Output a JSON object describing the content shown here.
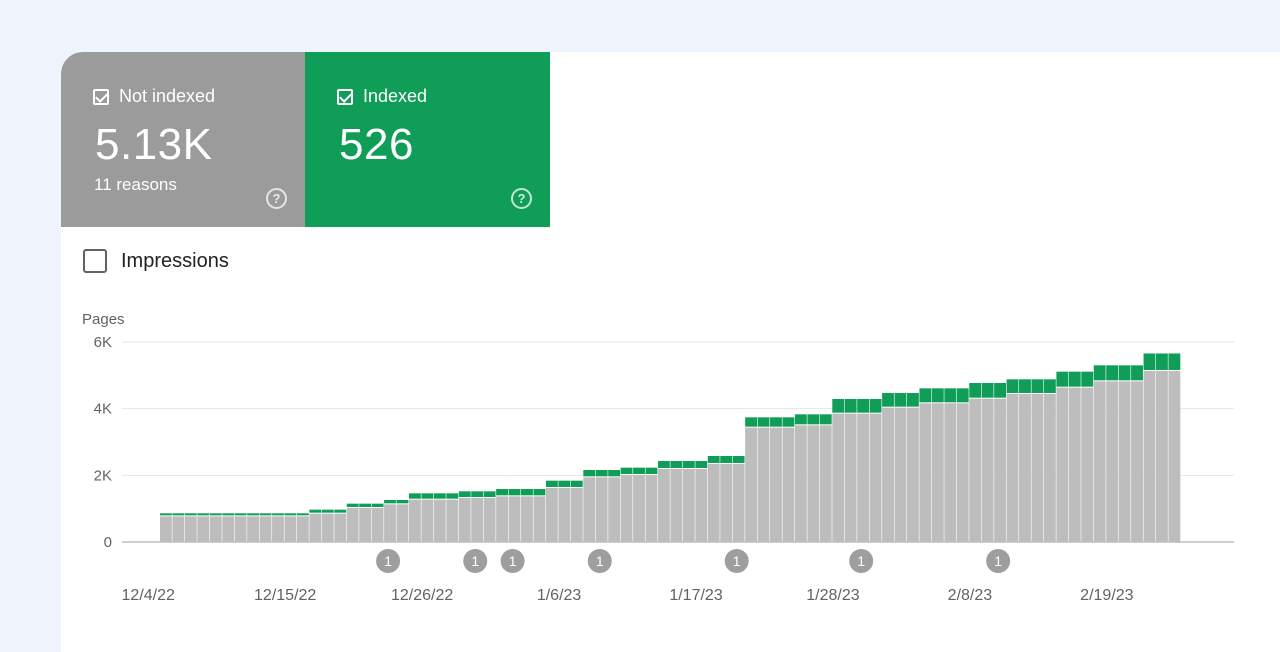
{
  "tiles": {
    "not_indexed": {
      "label": "Not indexed",
      "value": "5.13K",
      "sub": "11 reasons",
      "color": "#9b9b9b"
    },
    "indexed": {
      "label": "Indexed",
      "value": "526",
      "color": "#0f9d58"
    }
  },
  "impressions_label": "Impressions",
  "chart_data": {
    "type": "bar",
    "stacked": true,
    "ylabel": "Pages",
    "ylim": [
      0,
      6000
    ],
    "yticks": [
      "0",
      "2K",
      "4K",
      "6K"
    ],
    "ytick_values": [
      0,
      2000,
      4000,
      6000
    ],
    "grid": true,
    "x_tick_labels": [
      "12/4/22",
      "12/15/22",
      "12/26/22",
      "1/6/23",
      "1/17/23",
      "1/28/23",
      "2/8/23",
      "2/19/23"
    ],
    "x_tick_index": [
      0,
      11,
      22,
      33,
      44,
      55,
      66,
      77
    ],
    "series": [
      {
        "name": "Not indexed",
        "color": "#bdbdbd",
        "values": [
          770,
          770,
          770,
          770,
          770,
          770,
          770,
          770,
          770,
          770,
          770,
          770,
          850,
          850,
          850,
          1020,
          1020,
          1020,
          1130,
          1130,
          1270,
          1270,
          1270,
          1270,
          1320,
          1320,
          1320,
          1370,
          1370,
          1370,
          1370,
          1620,
          1620,
          1620,
          1940,
          1940,
          1940,
          2010,
          2010,
          2010,
          2190,
          2190,
          2190,
          2190,
          2340,
          2340,
          2340,
          3430,
          3430,
          3430,
          3430,
          3500,
          3500,
          3500,
          3850,
          3850,
          3850,
          3850,
          4030,
          4030,
          4030,
          4160,
          4160,
          4160,
          4160,
          4300,
          4300,
          4300,
          4440,
          4440,
          4440,
          4440,
          4630,
          4630,
          4630,
          4820,
          4820,
          4820,
          4820,
          5130,
          5130,
          5130
        ]
      },
      {
        "name": "Indexed",
        "color": "#0f9d58",
        "values": [
          90,
          90,
          90,
          90,
          90,
          90,
          90,
          90,
          90,
          90,
          90,
          90,
          120,
          120,
          120,
          130,
          130,
          130,
          130,
          130,
          190,
          190,
          190,
          190,
          200,
          200,
          200,
          220,
          220,
          220,
          220,
          220,
          220,
          220,
          220,
          220,
          220,
          220,
          220,
          220,
          240,
          240,
          240,
          240,
          240,
          240,
          240,
          310,
          310,
          310,
          310,
          330,
          330,
          330,
          440,
          440,
          440,
          440,
          440,
          440,
          440,
          450,
          450,
          450,
          450,
          470,
          470,
          470,
          440,
          440,
          440,
          440,
          480,
          480,
          480,
          480,
          480,
          480,
          480,
          526,
          526,
          526
        ]
      }
    ],
    "annotations": [
      {
        "index": 18,
        "label": "1"
      },
      {
        "index": 25,
        "label": "1"
      },
      {
        "index": 28,
        "label": "1"
      },
      {
        "index": 35,
        "label": "1"
      },
      {
        "index": 46,
        "label": "1"
      },
      {
        "index": 56,
        "label": "1"
      },
      {
        "index": 67,
        "label": "1"
      }
    ]
  }
}
